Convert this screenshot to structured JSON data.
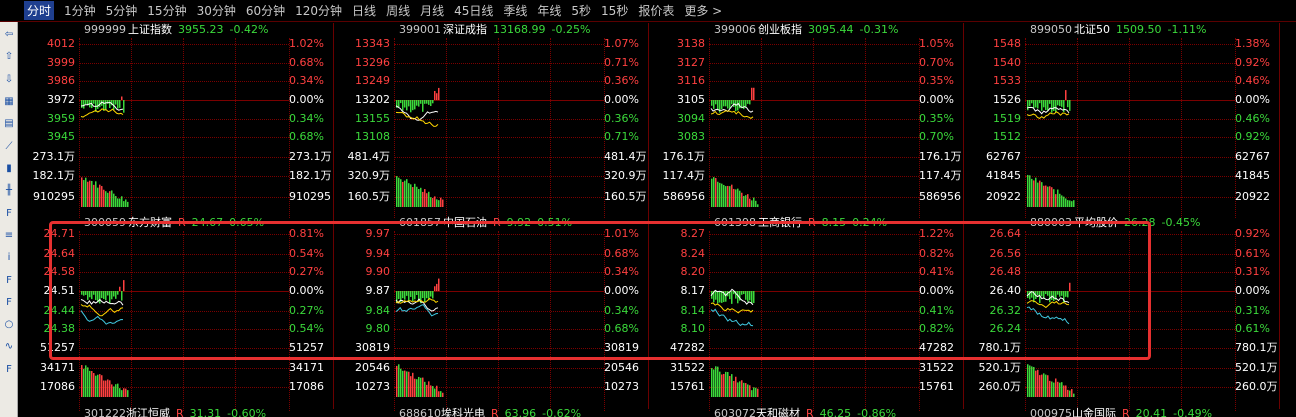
{
  "toolbar": {
    "items": [
      "分时",
      "1分钟",
      "5分钟",
      "15分钟",
      "30分钟",
      "60分钟",
      "120分钟",
      "日线",
      "周线",
      "月线",
      "45日线",
      "季线",
      "年线",
      "5秒",
      "15秒",
      "报价表",
      "更多 >"
    ]
  },
  "colors": {
    "up": "#ff4040",
    "down": "#3bd93b",
    "flat": "#ffffff",
    "grid": "#7a0000",
    "highlight": "#e63030"
  },
  "panels": [
    {
      "code": "999999",
      "name": "上证指数",
      "price": "3955.23",
      "pct": "-0.42%",
      "tag": "",
      "left": [
        "4012",
        "3999",
        "3986",
        "3972",
        "3959",
        "3945",
        "273.1万",
        "182.1万",
        "910295"
      ],
      "right": [
        "1.02%",
        "0.68%",
        "0.34%",
        "0.00%",
        "0.34%",
        "0.68%",
        "273.1万",
        "182.1万",
        "910295"
      ]
    },
    {
      "code": "399001",
      "name": "深证成指",
      "price": "13168.99",
      "pct": "-0.25%",
      "tag": "",
      "left": [
        "13343",
        "13296",
        "13249",
        "13202",
        "13155",
        "13108",
        "481.4万",
        "320.9万",
        "160.5万"
      ],
      "right": [
        "1.07%",
        "0.71%",
        "0.36%",
        "0.00%",
        "0.36%",
        "0.71%",
        "481.4万",
        "320.9万",
        "160.5万"
      ]
    },
    {
      "code": "399006",
      "name": "创业板指",
      "price": "3095.44",
      "pct": "-0.31%",
      "tag": "",
      "left": [
        "3138",
        "3127",
        "3116",
        "3105",
        "3094",
        "3083",
        "176.1万",
        "117.4万",
        "586956"
      ],
      "right": [
        "1.05%",
        "0.70%",
        "0.35%",
        "0.00%",
        "0.35%",
        "0.70%",
        "176.1万",
        "117.4万",
        "586956"
      ]
    },
    {
      "code": "899050",
      "name": "北证50",
      "price": "1509.50",
      "pct": "-1.11%",
      "tag": "",
      "left": [
        "1548",
        "1540",
        "1533",
        "1526",
        "1519",
        "1512",
        "62767",
        "41845",
        "20922"
      ],
      "right": [
        "1.38%",
        "0.92%",
        "0.46%",
        "0.00%",
        "0.46%",
        "0.92%",
        "62767",
        "41845",
        "20922"
      ]
    },
    {
      "code": "300059",
      "name": "东方财富",
      "price": "24.67",
      "pct": "0.65%",
      "tag": "R",
      "left": [
        "24.71",
        "24.64",
        "24.58",
        "24.51",
        "24.44",
        "24.38",
        "51257",
        "34171",
        "17086"
      ],
      "right": [
        "0.81%",
        "0.54%",
        "0.27%",
        "0.00%",
        "0.27%",
        "0.54%",
        "51257",
        "34171",
        "17086"
      ]
    },
    {
      "code": "601857",
      "name": "中国石油",
      "price": "9.92",
      "pct": "0.51%",
      "tag": "R",
      "left": [
        "9.97",
        "9.94",
        "9.90",
        "9.87",
        "9.84",
        "9.80",
        "30819",
        "20546",
        "10273"
      ],
      "right": [
        "1.01%",
        "0.68%",
        "0.34%",
        "0.00%",
        "0.34%",
        "0.68%",
        "30819",
        "20546",
        "10273"
      ]
    },
    {
      "code": "601398",
      "name": "工商银行",
      "price": "8.15",
      "pct": "0.24%",
      "tag": "R",
      "left": [
        "8.27",
        "8.24",
        "8.20",
        "8.17",
        "8.14",
        "8.10",
        "47282",
        "31522",
        "15761"
      ],
      "right": [
        "1.22%",
        "0.82%",
        "0.41%",
        "0.00%",
        "0.41%",
        "0.82%",
        "47282",
        "31522",
        "15761"
      ]
    },
    {
      "code": "880003",
      "name": "平均股价",
      "price": "26.28",
      "pct": "-0.45%",
      "tag": "",
      "left": [
        "26.64",
        "26.56",
        "26.48",
        "26.40",
        "26.32",
        "26.24",
        "780.1万",
        "520.1万",
        "260.0万"
      ],
      "right": [
        "0.92%",
        "0.61%",
        "0.31%",
        "0.00%",
        "0.31%",
        "0.61%",
        "780.1万",
        "520.1万",
        "260.0万"
      ]
    }
  ],
  "bottom_row": [
    {
      "code": "301222",
      "name": "浙江恒威",
      "price": "31.31",
      "pct": "-0.60%",
      "tag": "R"
    },
    {
      "code": "688610",
      "name": "埃科光电",
      "price": "63.96",
      "pct": "-0.62%",
      "tag": "R"
    },
    {
      "code": "603072",
      "name": "天和磁材",
      "price": "46.25",
      "pct": "-0.86%",
      "tag": "R"
    },
    {
      "code": "000975",
      "name": "山金国际",
      "price": "20.41",
      "pct": "-0.49%",
      "tag": "R"
    }
  ]
}
